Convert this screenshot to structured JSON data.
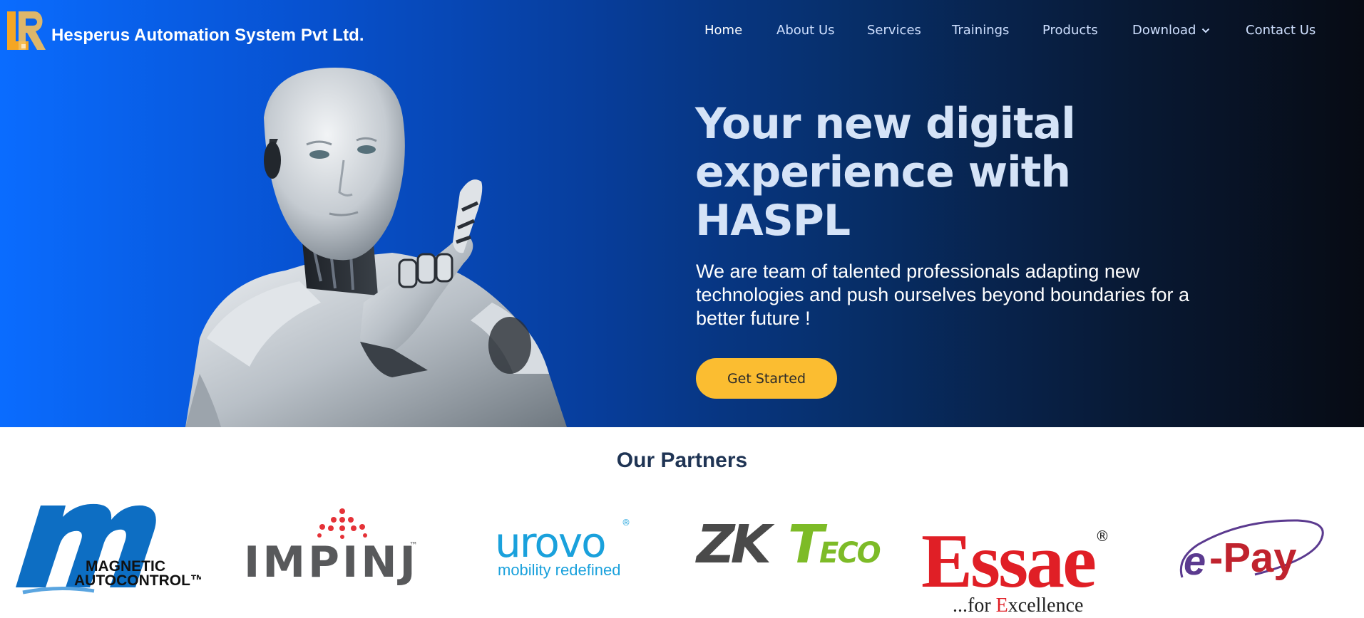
{
  "brand": {
    "name": "Hesperus Automation System Pvt Ltd.",
    "logo_icon": "hr-monogram-logo",
    "accent": "#fbbd31"
  },
  "nav": {
    "items": [
      {
        "label": "Home",
        "active": true
      },
      {
        "label": "About Us"
      },
      {
        "label": "Services"
      },
      {
        "label": "Trainings"
      },
      {
        "label": "Products"
      },
      {
        "label": "Download",
        "icon": "chevron-down-icon"
      },
      {
        "label": "Contact Us"
      }
    ]
  },
  "hero": {
    "headline_lines": [
      "Your new digital",
      "experience with",
      "HASPL"
    ],
    "subtext": "We are team of talented professionals adapting new technologies and push ourselves beyond boundaries for a better future !",
    "cta_label": "Get Started",
    "image": "humanoid-robot-pointing"
  },
  "partners": {
    "title": "Our Partners",
    "logos": [
      {
        "name": "magnetic-autocontrol",
        "text_1": "MAGNETIC",
        "text_2": "AUTOCONTROL™"
      },
      {
        "name": "impinj",
        "text": "IMPINJ",
        "mark": "™"
      },
      {
        "name": "urovo",
        "text": "urovo",
        "mark": "®",
        "tagline": "mobility redefined"
      },
      {
        "name": "zkteco",
        "text_1": "ZK",
        "text_2": "T",
        "text_3": "ECO"
      },
      {
        "name": "essae",
        "text": "Essae",
        "mark": "®",
        "tagline_1": "...for ",
        "tagline_2": "E",
        "tagline_3": "xcellence"
      },
      {
        "name": "e-pay",
        "text_1": "e",
        "text_2": "-Pay"
      }
    ]
  }
}
